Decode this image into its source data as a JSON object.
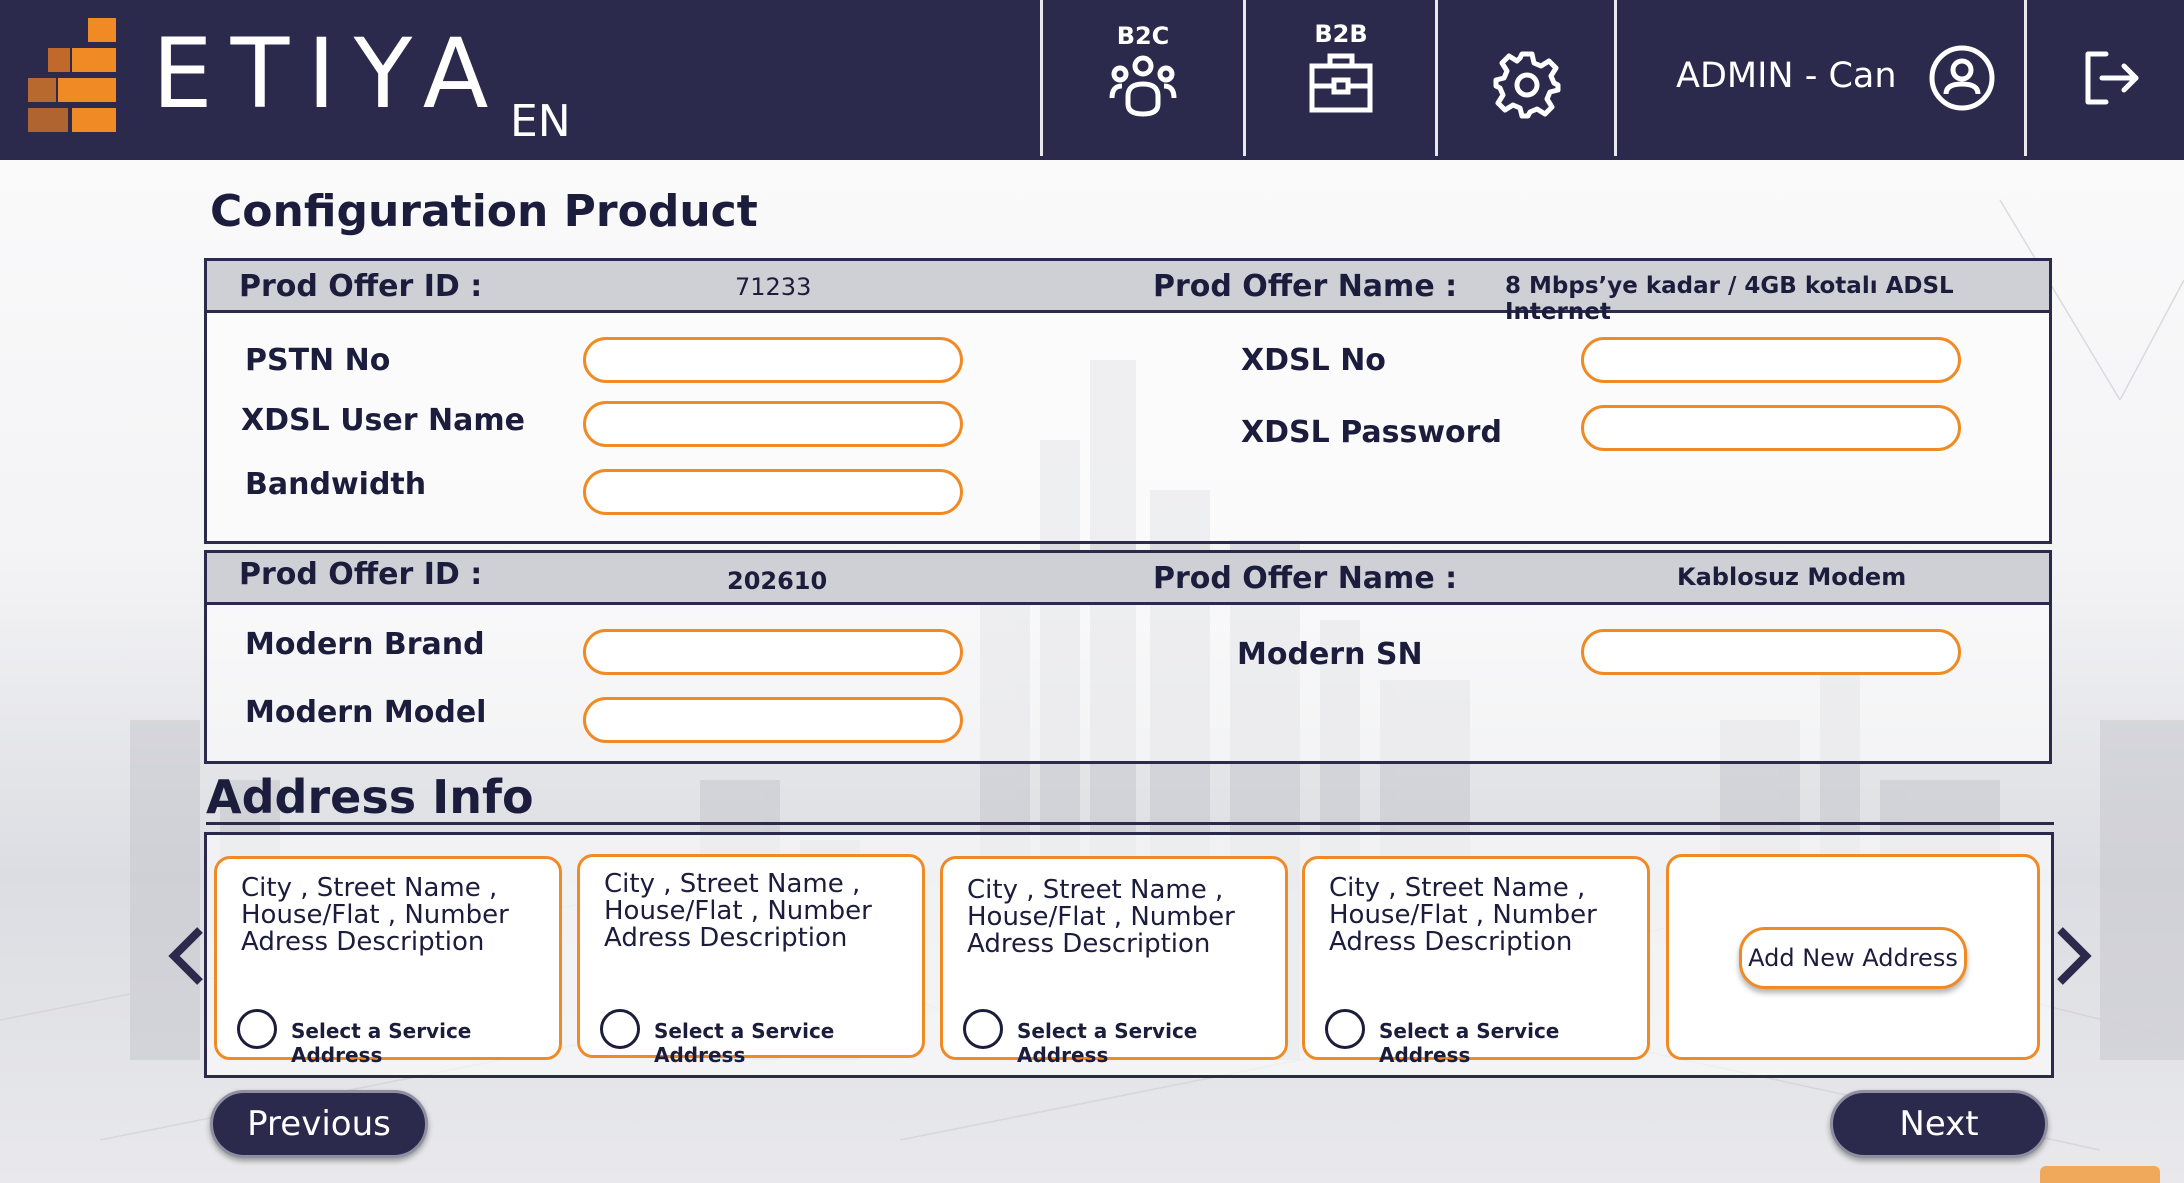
{
  "header": {
    "brand": "ETIYA",
    "lang": "EN",
    "b2c_label": "B2C",
    "b2b_label": "B2B",
    "user_label": "ADMIN - Can",
    "icons": [
      "b2c-people-icon",
      "b2b-briefcase-icon",
      "gear-icon",
      "user-avatar-icon",
      "logout-icon"
    ],
    "colors": {
      "bar": "#2b2a4c",
      "accent": "#f08a24"
    }
  },
  "page_title": "Configuration Product",
  "offers": [
    {
      "id_label": "Prod Offer ID :",
      "id_value": "71233",
      "name_label": "Prod Offer Name :",
      "name_value": "8 Mbps’ye kadar / 4GB kotalı ADSL Internet",
      "fields": {
        "pstn_no": {
          "label": "PSTN No",
          "value": ""
        },
        "xdsl_no": {
          "label": "XDSL No",
          "value": ""
        },
        "xdsl_user": {
          "label": "XDSL User Name",
          "value": ""
        },
        "xdsl_password": {
          "label": "XDSL Password",
          "value": ""
        },
        "bandwidth": {
          "label": "Bandwidth",
          "value": ""
        }
      }
    },
    {
      "id_label": "Prod Offer ID :",
      "id_value": "202610",
      "name_label": "Prod Offer Name :",
      "name_value": "Kablosuz Modem",
      "fields": {
        "modem_brand": {
          "label": "Modern Brand",
          "value": ""
        },
        "modem_sn": {
          "label": "Modern SN",
          "value": ""
        },
        "modem_model": {
          "label": "Modern Model",
          "value": ""
        }
      }
    }
  ],
  "address": {
    "title": "Address Info",
    "cards": [
      {
        "line1": "City , Street Name ,",
        "line2": "House/Flat , Number",
        "line3": "Adress Description",
        "radio_label": "Select a Service Address"
      },
      {
        "line1": "City , Street Name ,",
        "line2": "House/Flat , Number",
        "line3": "Adress Description",
        "radio_label": "Select a Service Address"
      },
      {
        "line1": "City , Street Name ,",
        "line2": "House/Flat , Number",
        "line3": "Adress Description",
        "radio_label": "Select a Service Address"
      },
      {
        "line1": "City , Street Name ,",
        "line2": "House/Flat , Number",
        "line3": "Adress Description",
        "radio_label": "Select a Service Address"
      }
    ],
    "add_label": "Add New Address"
  },
  "nav": {
    "previous": "Previous",
    "next": "Next"
  }
}
